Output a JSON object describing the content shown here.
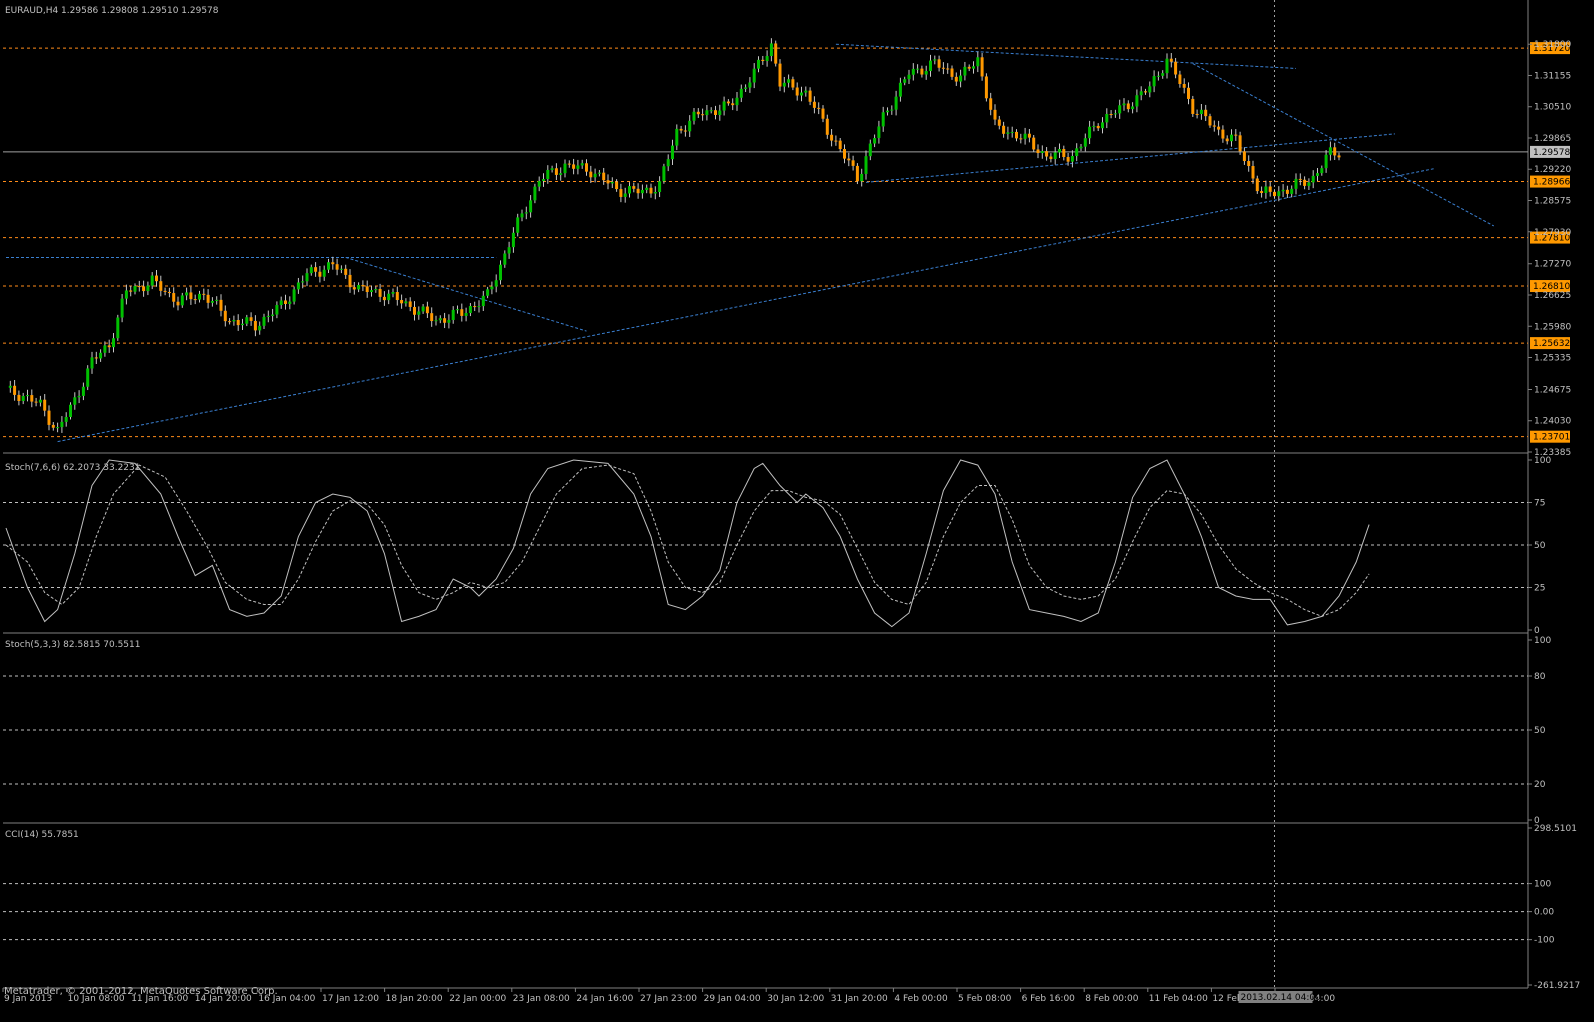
{
  "window": {
    "symbol_header": "EURAUD,H4  1.29586 1.29808 1.29510 1.29578",
    "footer": "Metatrader, © 2001-2012, MetaQuotes Software Corp.",
    "cursor_time_label": "2013.02.14 04:00"
  },
  "colors": {
    "background": "#000000",
    "bull_candle": "#00c000",
    "bear_candle": "#ff9900",
    "wick": "#c8c8c8",
    "grid_line": "#c0c0c0",
    "level_line": "#ff8c1a",
    "trend_line": "#3a7fd0",
    "stoch_main": "#c0c0c0",
    "stoch_signal": "#c0c0c0",
    "axis_text": "#c0c0c0",
    "price_tag_bg": "#ff9900",
    "current_price_tag_bg": "#c0c0c0"
  },
  "chart_data": [
    {
      "type": "candlestick",
      "title": "EURAUD,H4  1.29586 1.29808 1.29510 1.29578",
      "ylim": [
        1.23385,
        1.323
      ],
      "y_ticks": [
        "1.31800",
        "1.31155",
        "1.30510",
        "1.29865",
        "1.29220",
        "1.28575",
        "1.27930",
        "1.27270",
        "1.26625",
        "1.25980",
        "1.25335",
        "1.24675",
        "1.24030",
        "1.23385"
      ],
      "x_labels": [
        "9 Jan 2013",
        "10 Jan 08:00",
        "11 Jan 16:00",
        "14 Jan 20:00",
        "16 Jan 04:00",
        "17 Jan 12:00",
        "18 Jan 20:00",
        "22 Jan 00:00",
        "23 Jan 08:00",
        "24 Jan 16:00",
        "27 Jan 23:00",
        "29 Jan 04:00",
        "30 Jan 12:00",
        "31 Jan 20:00",
        "4 Feb 00:00",
        "5 Feb 08:00",
        "6 Feb 16:00",
        "8 Feb 00:00",
        "11 Feb 04:00",
        "12 Feb 12:00",
        "15 Feb 04:00"
      ],
      "price_levels": [
        {
          "label": "1.31720",
          "value": 1.3172
        },
        {
          "label": "1.28966",
          "value": 1.28966
        },
        {
          "label": "1.27810",
          "value": 1.2781
        },
        {
          "label": "1.26810",
          "value": 1.2681
        },
        {
          "label": "1.25632",
          "value": 1.25632
        },
        {
          "label": "1.23701",
          "value": 1.23701
        }
      ],
      "current_price": {
        "label": "1.29578",
        "value": 1.29578
      },
      "ohlc_anchor_closes": [
        [
          0,
          1.2465
        ],
        [
          4,
          1.2455
        ],
        [
          8,
          1.2435
        ],
        [
          12,
          1.2382
        ],
        [
          16,
          1.2445
        ],
        [
          20,
          1.2525
        ],
        [
          24,
          1.256
        ],
        [
          28,
          1.267
        ],
        [
          34,
          1.269
        ],
        [
          40,
          1.265
        ],
        [
          46,
          1.2665
        ],
        [
          52,
          1.261
        ],
        [
          58,
          1.26
        ],
        [
          64,
          1.264
        ],
        [
          70,
          1.2705
        ],
        [
          76,
          1.2725
        ],
        [
          82,
          1.2675
        ],
        [
          88,
          1.2665
        ],
        [
          94,
          1.264
        ],
        [
          100,
          1.261
        ],
        [
          106,
          1.2625
        ],
        [
          112,
          1.266
        ],
        [
          118,
          1.279
        ],
        [
          124,
          1.29
        ],
        [
          130,
          1.293
        ],
        [
          136,
          1.292
        ],
        [
          142,
          1.288
        ],
        [
          148,
          1.2875
        ],
        [
          152,
          1.289
        ],
        [
          156,
          1.3
        ],
        [
          162,
          1.304
        ],
        [
          168,
          1.305
        ],
        [
          174,
          1.312
        ],
        [
          178,
          1.318
        ],
        [
          180,
          1.31
        ],
        [
          186,
          1.308
        ],
        [
          192,
          1.299
        ],
        [
          198,
          1.2905
        ],
        [
          204,
          1.303
        ],
        [
          210,
          1.312
        ],
        [
          216,
          1.314
        ],
        [
          222,
          1.311
        ],
        [
          226,
          1.315
        ],
        [
          230,
          1.301
        ],
        [
          236,
          1.299
        ],
        [
          242,
          1.295
        ],
        [
          248,
          1.295
        ],
        [
          254,
          1.302
        ],
        [
          260,
          1.305
        ],
        [
          266,
          1.309
        ],
        [
          270,
          1.315
        ],
        [
          276,
          1.305
        ],
        [
          282,
          1.3
        ],
        [
          286,
          1.298
        ],
        [
          292,
          1.287
        ],
        [
          298,
          1.288
        ],
        [
          304,
          1.2905
        ],
        [
          308,
          1.2955
        ],
        [
          310,
          1.29578
        ]
      ],
      "trend_lines": [
        {
          "from": [
            12,
            1.236
          ],
          "to": [
            332,
            1.2923
          ]
        },
        {
          "from": [
            0,
            1.274
          ],
          "to": [
            114,
            1.274
          ]
        },
        {
          "from": [
            79,
            1.274
          ],
          "to": [
            135,
            1.2588
          ]
        },
        {
          "from": [
            193,
            1.318
          ],
          "to": [
            300,
            1.313
          ]
        },
        {
          "from": [
            200,
            1.2895
          ],
          "to": [
            323,
            1.2995
          ]
        },
        {
          "from": [
            276,
            1.314
          ],
          "to": [
            346,
            1.2805
          ]
        }
      ]
    },
    {
      "type": "line",
      "title": "Stoch(7,6,6) 62.2073 33.2231",
      "ylim": [
        0,
        100
      ],
      "y_ticks": [
        "100",
        "75",
        "50",
        "25",
        "0"
      ],
      "series": [
        {
          "style": "solid",
          "points": [
            [
              0,
              60
            ],
            [
              5,
              25
            ],
            [
              9,
              5
            ],
            [
              12,
              12
            ],
            [
              16,
              45
            ],
            [
              20,
              85
            ],
            [
              24,
              100
            ],
            [
              30,
              98
            ],
            [
              36,
              80
            ],
            [
              40,
              55
            ],
            [
              44,
              32
            ],
            [
              48,
              38
            ],
            [
              52,
              12
            ],
            [
              56,
              8
            ],
            [
              60,
              10
            ],
            [
              64,
              20
            ],
            [
              68,
              55
            ],
            [
              72,
              75
            ],
            [
              76,
              80
            ],
            [
              80,
              78
            ],
            [
              84,
              70
            ],
            [
              88,
              45
            ],
            [
              92,
              5
            ],
            [
              96,
              8
            ],
            [
              100,
              12
            ],
            [
              104,
              30
            ],
            [
              108,
              25
            ],
            [
              110,
              20
            ],
            [
              114,
              30
            ],
            [
              118,
              48
            ],
            [
              122,
              80
            ],
            [
              126,
              95
            ],
            [
              132,
              100
            ],
            [
              140,
              98
            ],
            [
              146,
              80
            ],
            [
              150,
              55
            ],
            [
              154,
              15
            ],
            [
              158,
              12
            ],
            [
              162,
              20
            ],
            [
              166,
              35
            ],
            [
              170,
              75
            ],
            [
              174,
              95
            ],
            [
              176,
              98
            ],
            [
              180,
              85
            ],
            [
              184,
              75
            ],
            [
              186,
              80
            ],
            [
              190,
              72
            ],
            [
              194,
              55
            ],
            [
              198,
              30
            ],
            [
              202,
              10
            ],
            [
              206,
              2
            ],
            [
              210,
              10
            ],
            [
              214,
              45
            ],
            [
              218,
              82
            ],
            [
              222,
              100
            ],
            [
              226,
              97
            ],
            [
              230,
              80
            ],
            [
              234,
              40
            ],
            [
              238,
              12
            ],
            [
              242,
              10
            ],
            [
              246,
              8
            ],
            [
              250,
              5
            ],
            [
              254,
              10
            ],
            [
              258,
              40
            ],
            [
              262,
              78
            ],
            [
              266,
              95
            ],
            [
              270,
              100
            ],
            [
              274,
              80
            ],
            [
              278,
              55
            ],
            [
              282,
              25
            ],
            [
              286,
              20
            ],
            [
              290,
              18
            ],
            [
              294,
              18
            ],
            [
              298,
              3
            ],
            [
              302,
              5
            ],
            [
              306,
              8
            ],
            [
              310,
              20
            ],
            [
              314,
              40
            ],
            [
              317,
              62
            ]
          ]
        },
        {
          "style": "dashed",
          "points": [
            [
              0,
              50
            ],
            [
              5,
              40
            ],
            [
              9,
              22
            ],
            [
              13,
              15
            ],
            [
              17,
              25
            ],
            [
              21,
              55
            ],
            [
              25,
              80
            ],
            [
              31,
              97
            ],
            [
              37,
              90
            ],
            [
              42,
              70
            ],
            [
              47,
              48
            ],
            [
              51,
              28
            ],
            [
              56,
              18
            ],
            [
              60,
              15
            ],
            [
              64,
              15
            ],
            [
              68,
              30
            ],
            [
              72,
              52
            ],
            [
              76,
              70
            ],
            [
              80,
              76
            ],
            [
              84,
              74
            ],
            [
              88,
              62
            ],
            [
              92,
              38
            ],
            [
              96,
              22
            ],
            [
              100,
              18
            ],
            [
              104,
              22
            ],
            [
              108,
              28
            ],
            [
              112,
              25
            ],
            [
              116,
              28
            ],
            [
              120,
              40
            ],
            [
              124,
              60
            ],
            [
              128,
              80
            ],
            [
              134,
              95
            ],
            [
              140,
              97
            ],
            [
              146,
              92
            ],
            [
              150,
              70
            ],
            [
              154,
              40
            ],
            [
              158,
              25
            ],
            [
              162,
              22
            ],
            [
              166,
              28
            ],
            [
              170,
              50
            ],
            [
              174,
              70
            ],
            [
              178,
              82
            ],
            [
              182,
              82
            ],
            [
              186,
              78
            ],
            [
              190,
              76
            ],
            [
              194,
              68
            ],
            [
              198,
              48
            ],
            [
              202,
              28
            ],
            [
              206,
              18
            ],
            [
              210,
              15
            ],
            [
              214,
              28
            ],
            [
              218,
              55
            ],
            [
              222,
              75
            ],
            [
              226,
              85
            ],
            [
              230,
              85
            ],
            [
              234,
              65
            ],
            [
              238,
              38
            ],
            [
              242,
              25
            ],
            [
              246,
              20
            ],
            [
              250,
              18
            ],
            [
              254,
              20
            ],
            [
              258,
              30
            ],
            [
              262,
              52
            ],
            [
              266,
              72
            ],
            [
              270,
              82
            ],
            [
              274,
              80
            ],
            [
              278,
              68
            ],
            [
              282,
              50
            ],
            [
              286,
              36
            ],
            [
              290,
              28
            ],
            [
              294,
              22
            ],
            [
              298,
              18
            ],
            [
              302,
              12
            ],
            [
              306,
              8
            ],
            [
              310,
              12
            ],
            [
              314,
              22
            ],
            [
              317,
              33
            ]
          ]
        }
      ]
    },
    {
      "type": "line",
      "title": "Stoch(5,3,3) 82.5815 70.5511",
      "ylim": [
        0,
        100
      ],
      "y_ticks": [
        "100",
        "80",
        "50",
        "20",
        "0"
      ],
      "series": []
    },
    {
      "type": "line",
      "title": "CCI(14) 55.7851",
      "ylim": [
        -261.9217,
        298.5101
      ],
      "y_ticks": [
        "298.5101",
        "100",
        "0.00",
        "-100",
        "-261.9217"
      ],
      "series": []
    }
  ]
}
